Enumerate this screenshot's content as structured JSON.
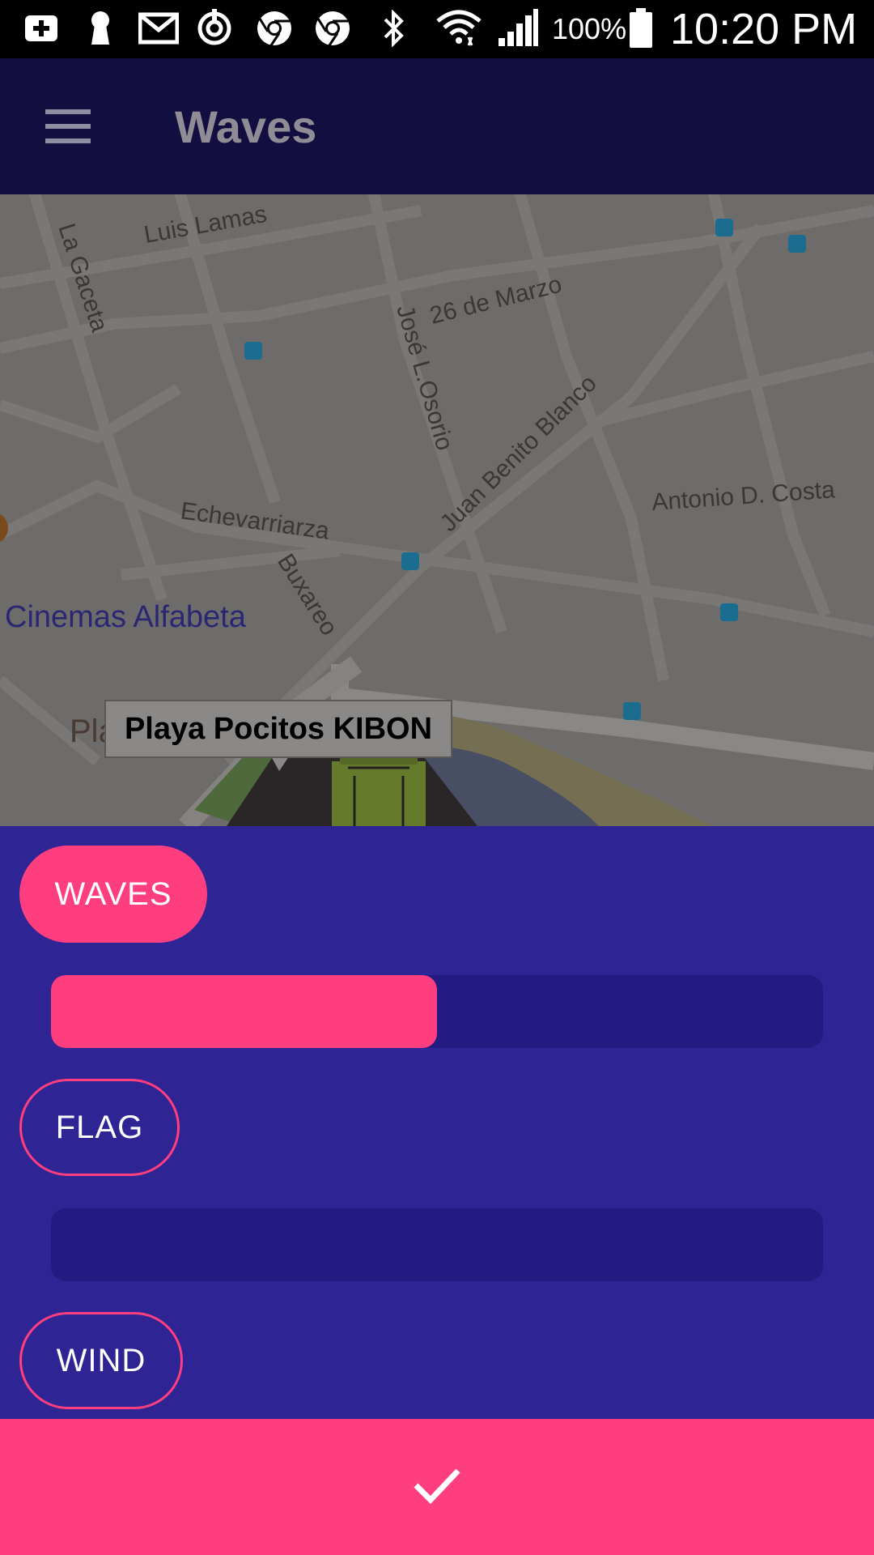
{
  "status_bar": {
    "battery_percent": "100%",
    "time": "10:20 PM",
    "icons": [
      "plus-box-icon",
      "keyhole-icon",
      "gmail-icon",
      "sync-icon",
      "chrome-icon",
      "chrome-icon",
      "bluetooth-icon",
      "wifi-icon",
      "signal-icon",
      "battery-icon"
    ]
  },
  "app_bar": {
    "title": "Waves",
    "menu_icon": "hamburger-icon"
  },
  "map": {
    "streets": [
      "Luis Lamas",
      "La Gaceta",
      "26 de Marzo",
      "José L.Osorio",
      "Juan Benito Blanco",
      "Antonio D. Costa",
      "Echevarriarza",
      "Buxareo"
    ],
    "place_label": "Cinemas Alfabeta",
    "partial_label": "Pla",
    "marker_tooltip": "Playa Pocitos KIBON",
    "marker_icon": "trash-can-icon"
  },
  "filters": [
    {
      "label": "WAVES",
      "selected": true,
      "level": 0.5
    },
    {
      "label": "FLAG",
      "selected": false,
      "level": 0
    },
    {
      "label": "WIND",
      "selected": false
    }
  ],
  "confirm": {
    "icon": "checkmark-icon"
  },
  "colors": {
    "accent": "#ff3e7f",
    "sheet": "#2e2494",
    "track": "#231b82",
    "app_bar": "#120f40"
  }
}
